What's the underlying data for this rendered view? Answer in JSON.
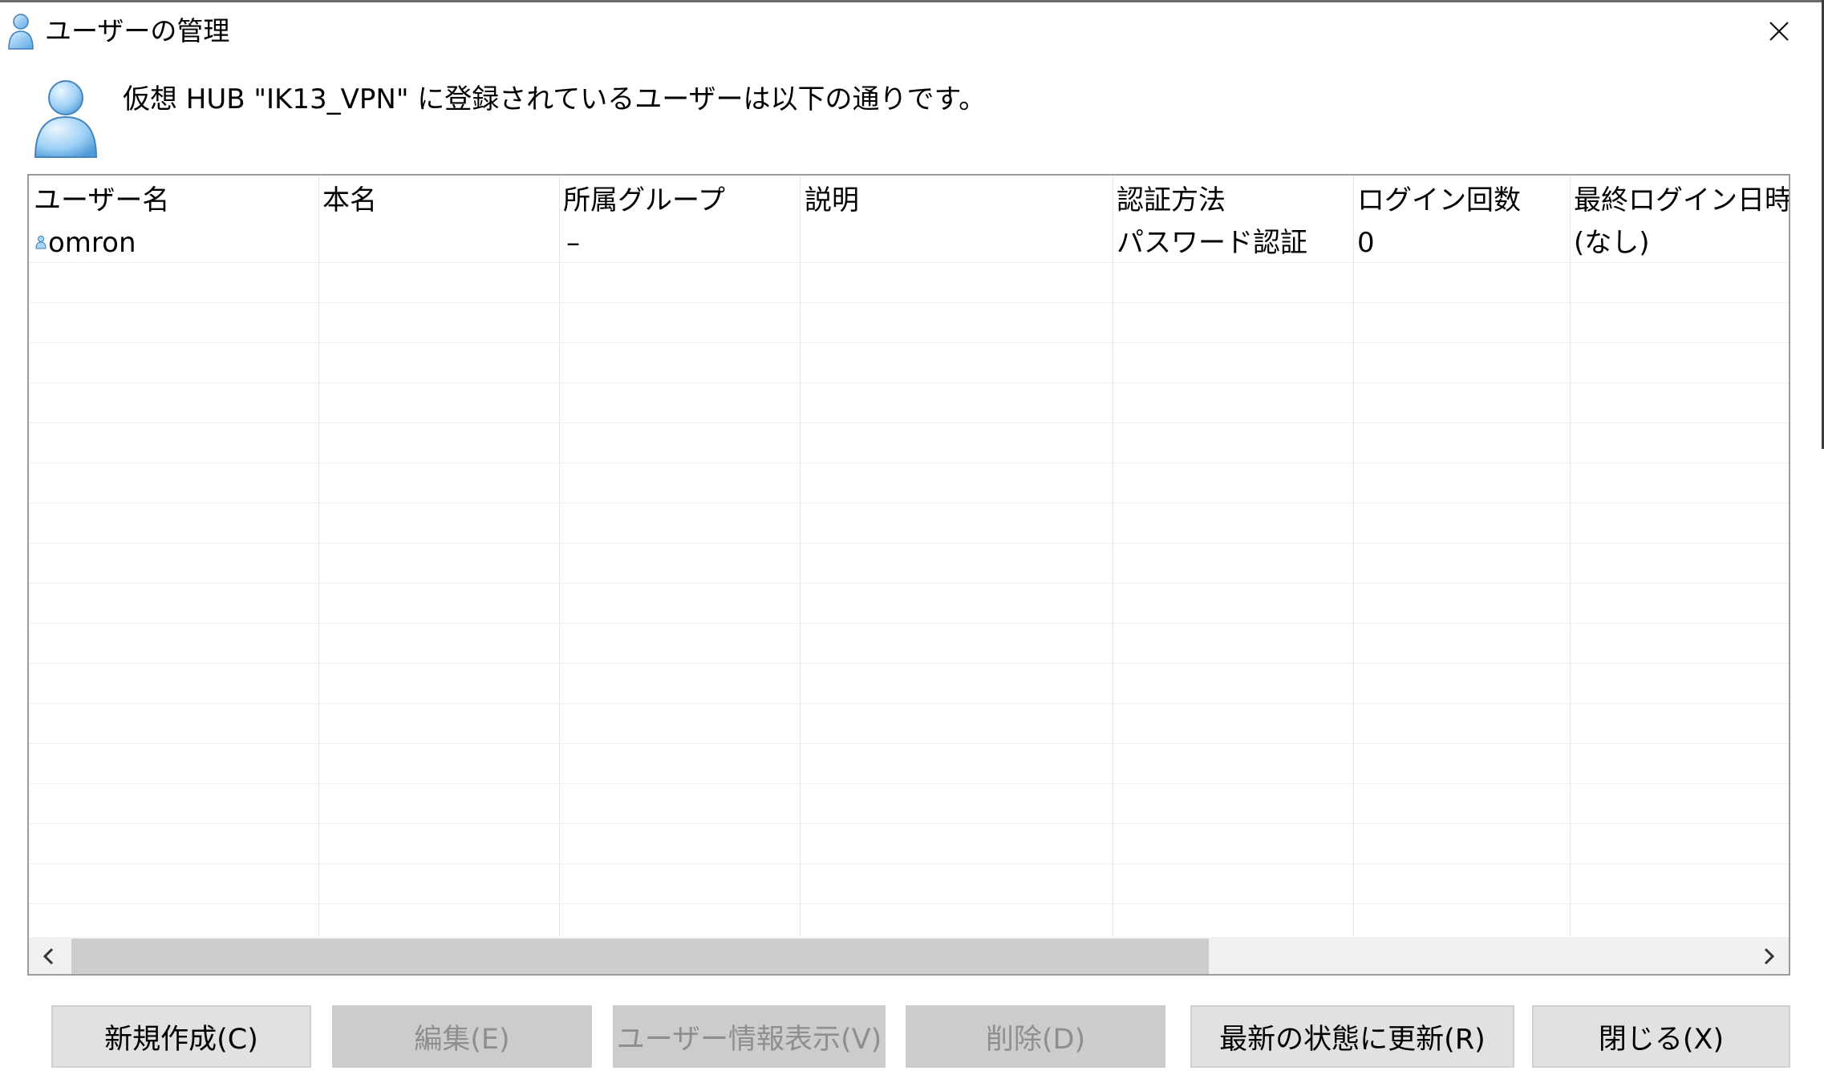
{
  "window": {
    "title": "ユーザーの管理",
    "close_icon": "close-icon"
  },
  "header": {
    "message": "仮想 HUB \"IK13_VPN\" に登録されているユーザーは以下の通りです。",
    "icon": "user-icon"
  },
  "table": {
    "columns": [
      "ユーザー名",
      "本名",
      "所属グループ",
      "説明",
      "認証方法",
      "ログイン回数",
      "最終ログイン日時"
    ],
    "rows": [
      {
        "user_name": "omron",
        "real_name": "",
        "group": "–",
        "description": "",
        "auth_method": "パスワード認証",
        "login_count": "0",
        "last_login": "(なし)"
      }
    ]
  },
  "scrollbar": {
    "left_icon": "chevron-left-icon",
    "right_icon": "chevron-right-icon"
  },
  "buttons": {
    "new": "新規作成(C)",
    "edit": "編集(E)",
    "view_info": "ユーザー情報表示(V)",
    "delete": "削除(D)",
    "refresh": "最新の状態に更新(R)",
    "close": "閉じる(X)"
  },
  "colors": {
    "button_bg": "#e1e1e1",
    "button_disabled_bg": "#cccccc",
    "disabled_text": "#8e8e8e",
    "scroll_thumb": "#cdcdcd",
    "user_icon_blue": "#6fb4ea"
  }
}
